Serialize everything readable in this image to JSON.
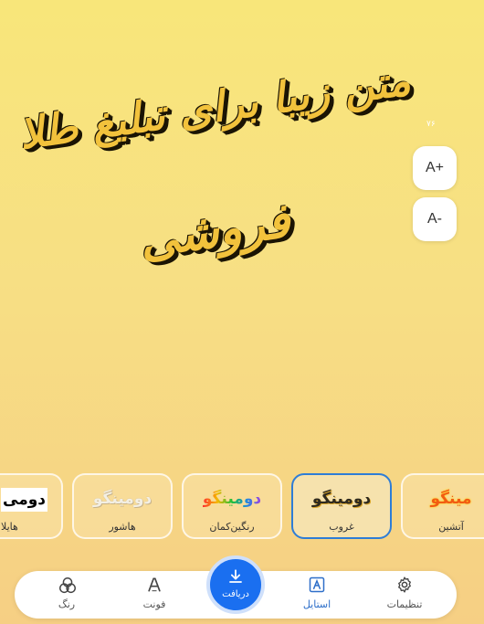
{
  "canvas": {
    "text_line1": "متن زیبا برای تبلیغ طلا",
    "text_line2": "فروشی",
    "size_label": "۷۶",
    "increase_label": "A+",
    "decrease_label": "A-"
  },
  "styles": [
    {
      "preview": "مینگو",
      "label": "آتشین",
      "selected": false
    },
    {
      "preview": "دومینگو",
      "label": "غروب",
      "selected": true
    },
    {
      "preview": "دومینگو",
      "label": "رنگین‌کمان",
      "selected": false
    },
    {
      "preview": "دومینگو",
      "label": "هاشور",
      "selected": false
    },
    {
      "preview": "دومی",
      "label": "هایلا",
      "selected": false
    }
  ],
  "nav": {
    "settings": "تنظیمات",
    "style": "استایل",
    "download": "دریافت",
    "font": "فونت",
    "color": "رنگ"
  },
  "colors": {
    "accent": "#1a6ff0",
    "selected_border": "#2e7dd6",
    "text_fill": "#f2c23c",
    "text_outline": "#1b1404"
  },
  "icons": {
    "settings": "gear-icon",
    "style": "style-a-icon",
    "download": "download-icon",
    "font": "font-a-icon",
    "color": "color-circles-icon"
  }
}
